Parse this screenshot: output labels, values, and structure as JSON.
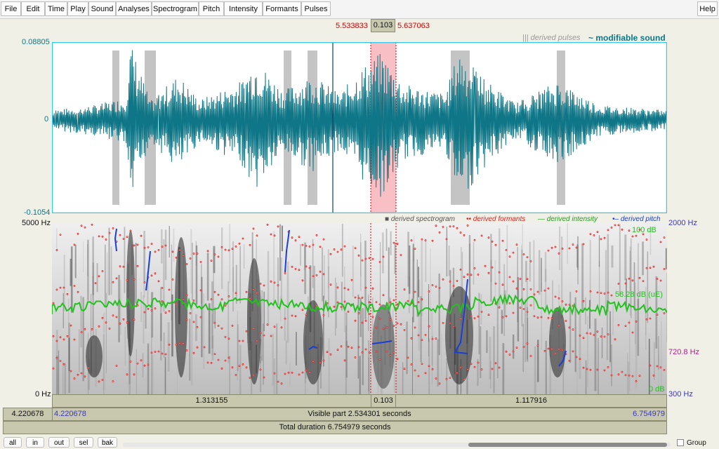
{
  "menu": {
    "items": [
      "File",
      "Edit",
      "Time",
      "Play",
      "Sound",
      "Analyses",
      "Spectrogram",
      "Pitch",
      "Intensity",
      "Formants",
      "Pulses"
    ],
    "help": "Help"
  },
  "selection": {
    "start": "5.533833",
    "duration": "0.103",
    "end": "5.637063"
  },
  "waveform": {
    "legend_pulses": "||| derived pulses",
    "legend_sound": "~ modifiable sound",
    "y_max": "0.08805",
    "y_zero": "0",
    "y_min": "-0.1054",
    "color": "#0e7686"
  },
  "spectrogram": {
    "legend": {
      "spectrogram": "derived spectrogram",
      "formants": "derived formants",
      "intensity": "derived intensity",
      "pitch": "derived pitch"
    },
    "freq_max": "5000 Hz",
    "freq_min": "0 Hz",
    "pitch_max": "2000 Hz",
    "pitch_value": "720.8 Hz",
    "pitch_min": "300 Hz",
    "intensity_max": "100 dB",
    "intensity_value": "58.28 dB (uE)",
    "intensity_min": "0 dB",
    "colors": {
      "formants": "#e02020",
      "intensity": "#22c21e",
      "pitch": "#1a3ed8"
    }
  },
  "timebars": {
    "segment_left": "1.313155",
    "segment_mid": "0.103",
    "segment_right": "1.117916",
    "window_left": "4.220678",
    "visible_start": "4.220678",
    "visible_label": "Visible part 2.534301 seconds",
    "visible_end": "6.754979",
    "total_label": "Total duration 6.754979 seconds"
  },
  "bottom": {
    "buttons": [
      "all",
      "in",
      "out",
      "sel",
      "bak"
    ],
    "group_label": "Group"
  }
}
